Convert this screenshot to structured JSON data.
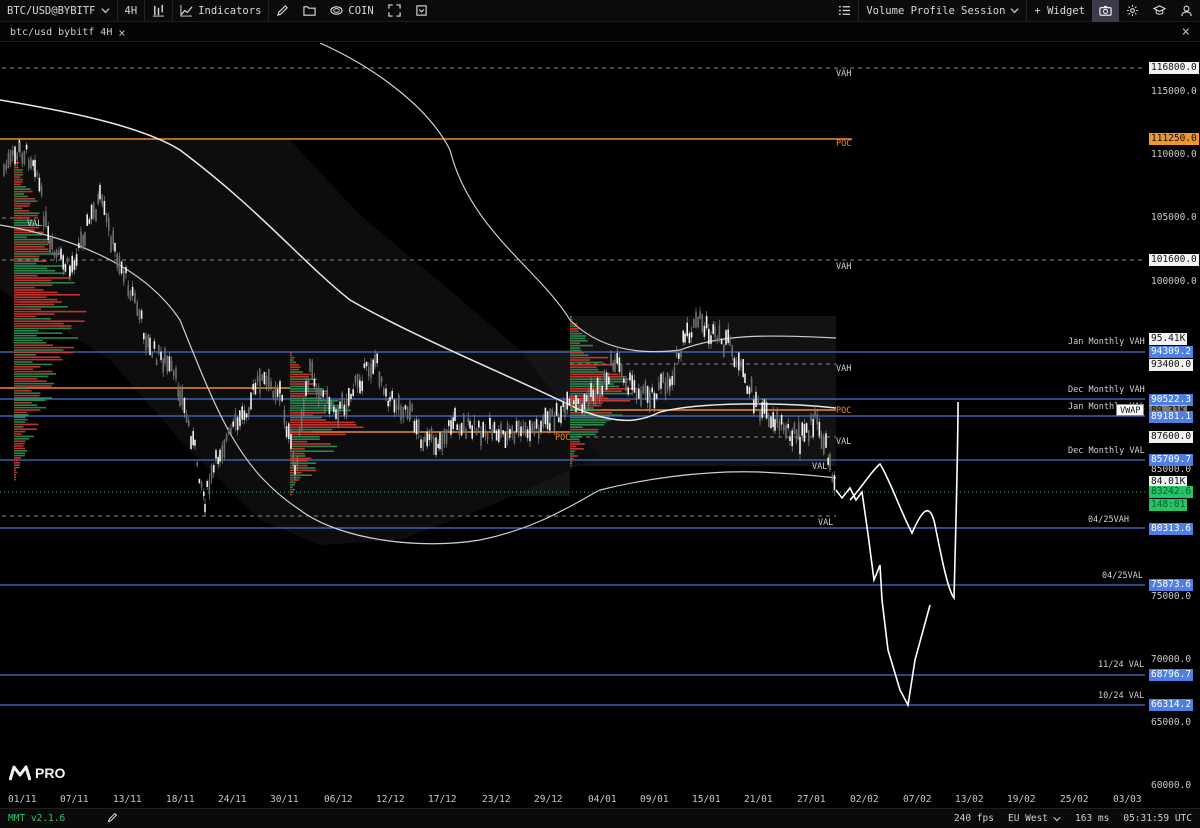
{
  "toolbar": {
    "symbol": "BTC/USD@BYBITF",
    "timeframe": "4H",
    "indicators_label": "Indicators",
    "coin_label": "COIN",
    "session_label": "Volume Profile Session",
    "widget_label": "+ Widget"
  },
  "tab": {
    "title": "btc/usd bybitf 4H"
  },
  "price_axis": [
    "115000.0",
    "110000.0",
    "105000.0",
    "100000.0",
    "85000.0",
    "75000.0",
    "70000.0",
    "65000.0",
    "60000.0"
  ],
  "price_tags": {
    "vah_top": "116800.0",
    "poc_top": "111250.0",
    "vah_mid": "101600.0",
    "volume_peak": "95.41K",
    "jan_vah": "94309.2",
    "vah_right": "93400.0",
    "dec_vah": "90522.3",
    "vwap_ghost": "89.31K",
    "jan_val": "89181.1",
    "val_right": "87600.0",
    "dec_val": "85709.7",
    "volume_low": "84.01K",
    "last_price": "83242.6",
    "countdown": "148:01",
    "vah_0425": "80313.6",
    "val_0425": "75873.6",
    "val_1124": "68796.7",
    "val_1024": "66314.2"
  },
  "level_labels": {
    "vah": "VAH",
    "poc": "POC",
    "val": "VAL",
    "jan_vah": "Jan Monthly VAH",
    "dec_vah": "Dec Monthly VAH",
    "jan_val": "Jan Monthly VAL",
    "dec_val": "Dec Monthly VAL",
    "vah_0425": "04/25VAH",
    "val_0425": "04/25VAL",
    "val_1124": "11/24 VAL",
    "val_1024": "10/24 VAL",
    "vwap": "VWAP"
  },
  "x_axis": [
    "01/11",
    "07/11",
    "13/11",
    "18/11",
    "24/11",
    "30/11",
    "06/12",
    "12/12",
    "17/12",
    "23/12",
    "29/12",
    "04/01",
    "09/01",
    "15/01",
    "21/01",
    "27/01",
    "02/02",
    "07/02",
    "13/02",
    "19/02",
    "25/02",
    "03/03"
  ],
  "logo": {
    "text": "PRO"
  },
  "status": {
    "version": "MMT v2.1.6",
    "fps": "240 fps",
    "region": "EU West",
    "latency": "163 ms",
    "time": "05:31:59 UTC"
  },
  "colors": {
    "level_blue": "#4a6fd6",
    "poc_orange": "#f08a2e",
    "last_price_green": "#27c26a",
    "volume_red": "#e53935",
    "volume_green": "#2e9e5b"
  }
}
